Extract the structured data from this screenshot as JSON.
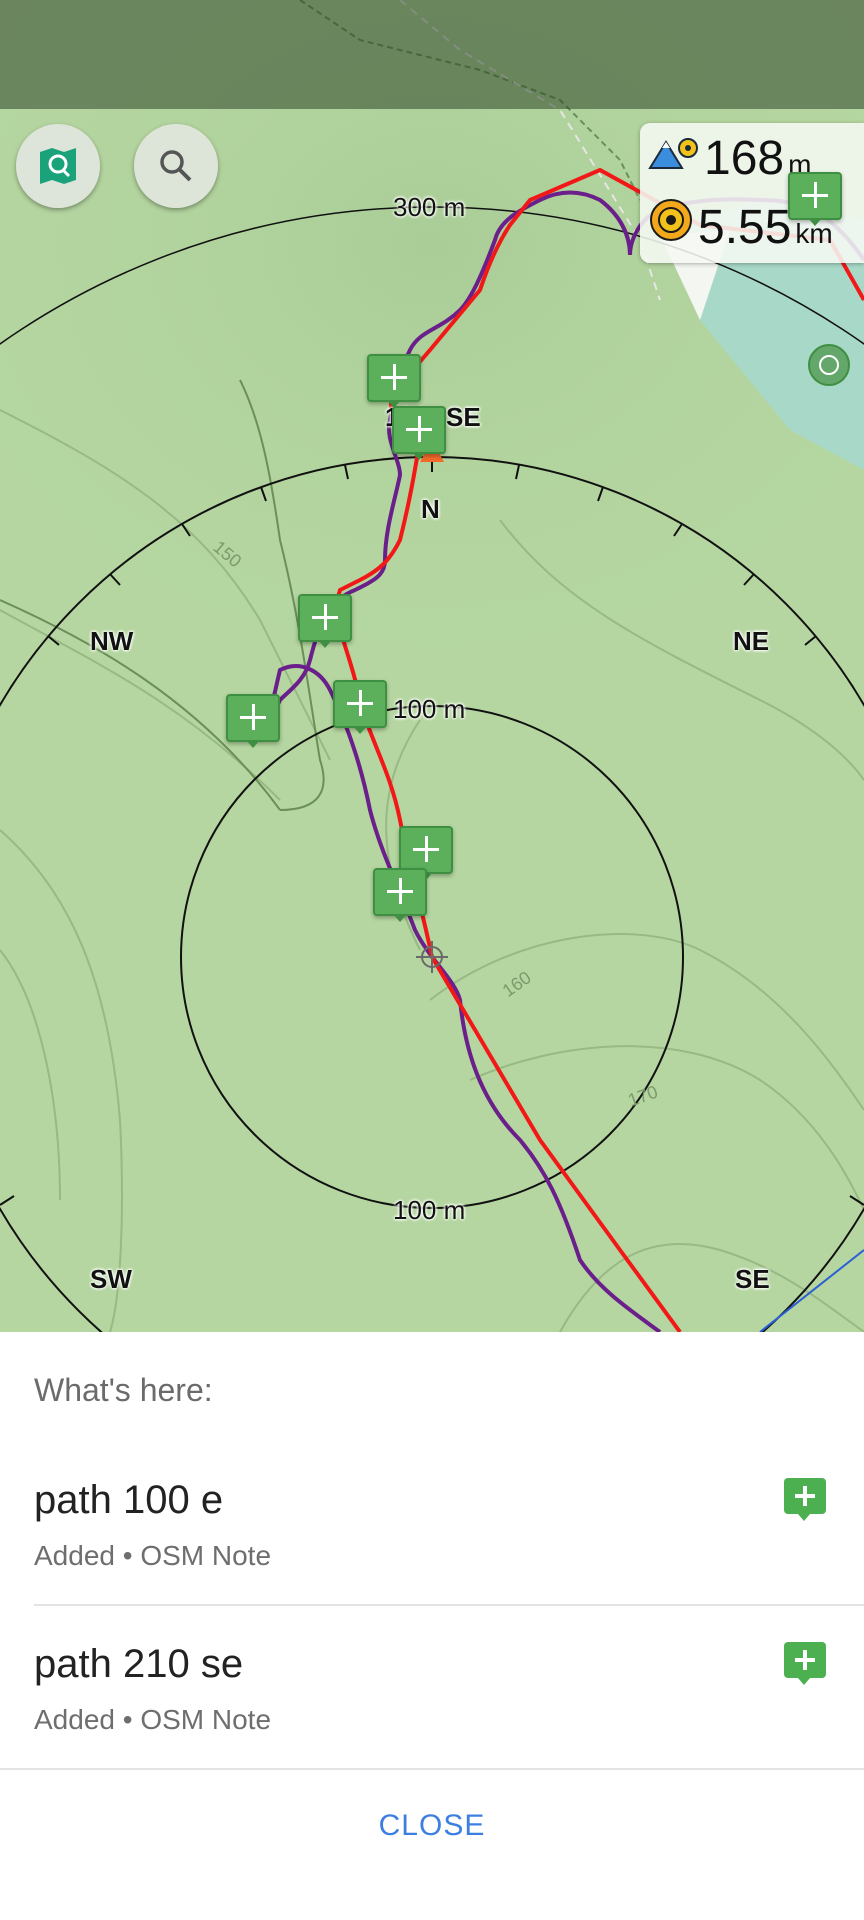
{
  "colors": {
    "track_red": "#f21818",
    "track_purple": "#6a1f8a",
    "map_green": "#b5d6a0",
    "note_green": "#5cb05c",
    "accent_blue": "#3d7fe0"
  },
  "map": {
    "compass": {
      "north": "N",
      "northwest": "NW",
      "northeast": "NE",
      "southwest": "SW",
      "southeast": "SE",
      "bearing": "139° SE"
    },
    "ring_labels": {
      "outer_top": "300 m",
      "inner_top": "100 m",
      "inner_bottom": "100 m"
    },
    "contour_labels": [
      "150",
      "160",
      "170"
    ],
    "info": {
      "altitude_value": "168",
      "altitude_unit": "m",
      "altitude_icon": "mountain-pin-icon",
      "distance_value": "5.55",
      "distance_unit": "km",
      "distance_icon": "target-icon"
    },
    "buttons": {
      "map_search_icon": "map-search-icon",
      "search_icon": "search-icon"
    }
  },
  "sheet": {
    "heading": "What's here:",
    "items": [
      {
        "title": "path 100 e",
        "subtitle": "Added • OSM Note",
        "icon": "osm-note-icon"
      },
      {
        "title": "path 210 se",
        "subtitle": "Added • OSM Note",
        "icon": "osm-note-icon"
      }
    ],
    "close_label": "CLOSE"
  }
}
